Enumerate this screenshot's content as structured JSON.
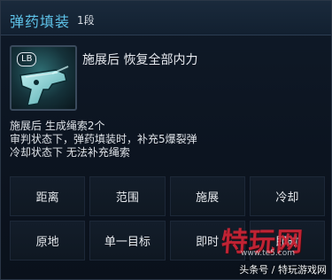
{
  "skill": {
    "name": "弹药填装",
    "level": "1段",
    "icon_label": "LB",
    "icon": "pistol-icon",
    "effect": "施展后 恢复全部内力"
  },
  "description": [
    "施展后 生成绳索2个",
    "审判状态下，弹药填装时，补充5爆裂弹",
    "冷却状态下 无法补充绳索"
  ],
  "attributes": [
    {
      "label": "距离"
    },
    {
      "label": "范围"
    },
    {
      "label": "施展"
    },
    {
      "label": "冷却"
    },
    {
      "label": "原地"
    },
    {
      "label": "单一目标"
    },
    {
      "label": "即时"
    },
    {
      "label": "即时"
    }
  ],
  "watermark": {
    "logo": "特玩网",
    "site": "www.te5.com",
    "credit": "头条号 / 特玩游戏网"
  },
  "colors": {
    "title": "#5ec2e8",
    "panel_bg": "#0e1521",
    "watermark": "#e0283c"
  }
}
